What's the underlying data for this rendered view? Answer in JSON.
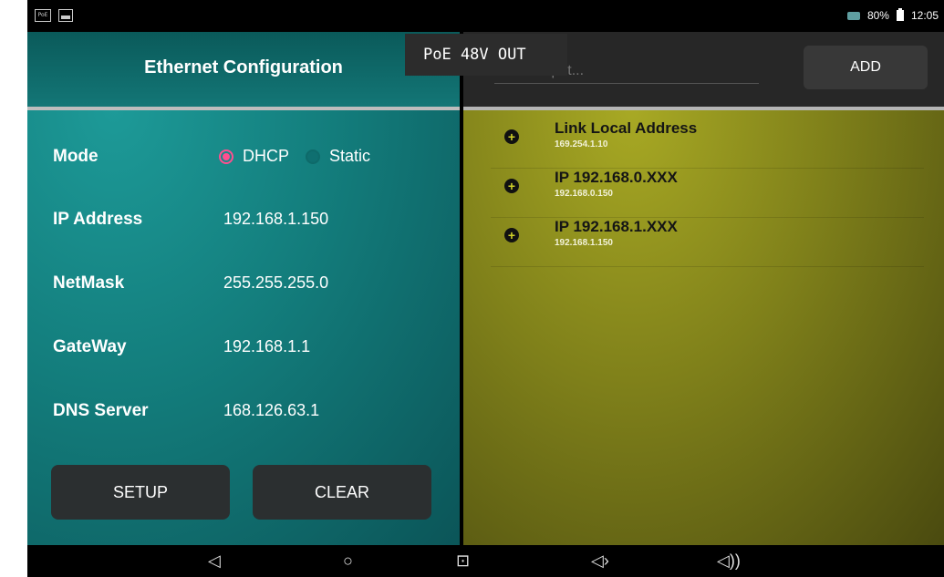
{
  "status_bar": {
    "battery": "80%",
    "time": "12:05",
    "icons": [
      "poe-icon",
      "image-icon",
      "ethernet-icon",
      "battery-icon"
    ]
  },
  "left_panel": {
    "title": "Ethernet Configuration",
    "mode": {
      "label": "Mode",
      "options": [
        "DHCP",
        "Static"
      ],
      "selected": "DHCP"
    },
    "fields": [
      {
        "label": "IP Address",
        "value": "192.168.1.150"
      },
      {
        "label": "NetMask",
        "value": "255.255.255.0"
      },
      {
        "label": "GateWay",
        "value": "192.168.1.1"
      },
      {
        "label": "DNS Server",
        "value": "168.126.63.1"
      }
    ],
    "buttons": {
      "setup": "SETUP",
      "clear": "CLEAR"
    }
  },
  "overlay": {
    "text": "PoE 48V OUT"
  },
  "right_panel": {
    "name_input": {
      "placeholder": "Name Input..."
    },
    "add_label": "ADD",
    "list": [
      {
        "title": "Link Local Address",
        "address": "169.254.1.10"
      },
      {
        "title": "IP 192.168.0.XXX",
        "address": "192.168.0.150"
      },
      {
        "title": "IP 192.168.1.XXX",
        "address": "192.168.1.150"
      }
    ]
  },
  "nav_bar": {
    "buttons": [
      "back-icon",
      "home-icon",
      "screenshot-icon",
      "volume-down-icon",
      "volume-up-icon"
    ],
    "glyphs": {
      "back": "◁",
      "home": "○",
      "screenshot": "⊡",
      "vol_down": "◁›",
      "vol_up": "◁))"
    }
  },
  "colors": {
    "left_bg": "#137d7c",
    "right_bg": "#8a8a1c",
    "radio_accent": "#ff4f8f",
    "button_bg": "#2b2f30"
  }
}
